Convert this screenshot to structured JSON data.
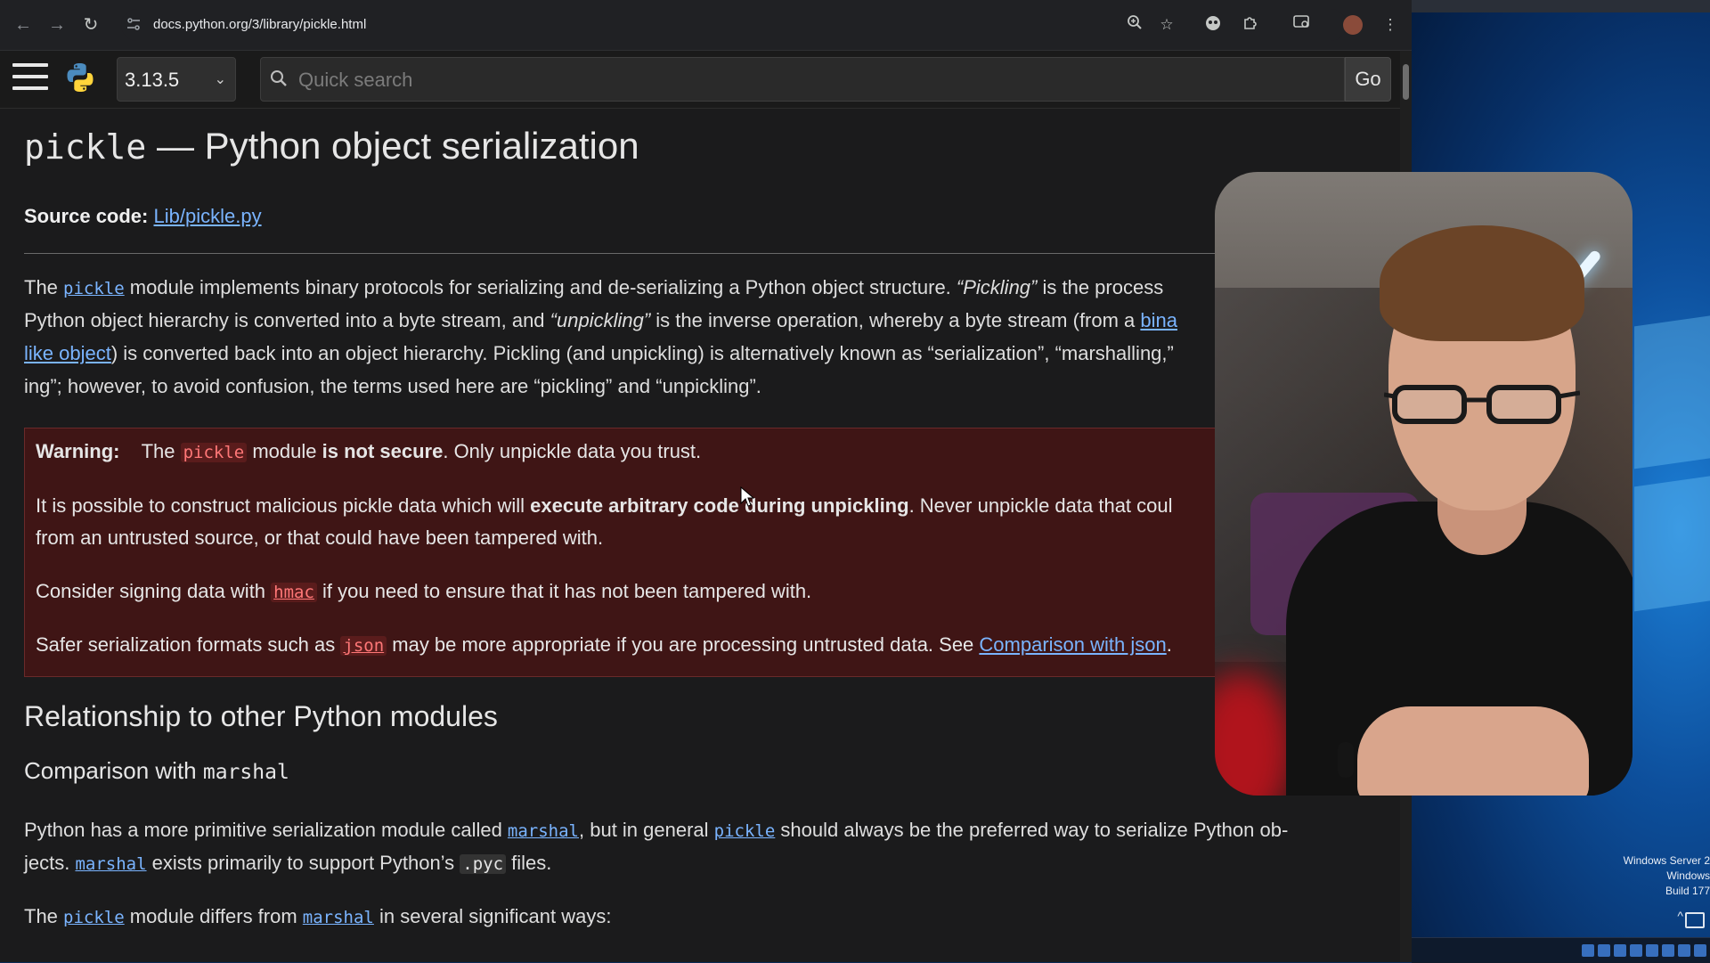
{
  "browser": {
    "url": "docs.python.org/3/library/pickle.html",
    "nav": {
      "back": "←",
      "forward": "→",
      "reload": "↻"
    },
    "icons": [
      "site-info-icon",
      "zoom-icon",
      "bookmark-star-icon",
      "extension-face-icon",
      "extensions-puzzle-icon",
      "tab-search-icon",
      "profile-avatar",
      "menu-dots-icon"
    ]
  },
  "docs_header": {
    "version": "3.13.5",
    "search_placeholder": "Quick search",
    "go_label": "Go"
  },
  "page": {
    "title_code": "pickle",
    "title_rest": " — Python object serialization",
    "source_label": "Source code:",
    "source_link": "Lib/pickle.py",
    "intro": {
      "l1_a": "The ",
      "l1_code": "pickle",
      "l1_b": " module implements binary protocols for serializing and de-serializing a Python object structure. ",
      "l1_em": "“Pickling”",
      "l1_c": " is the process",
      "l2_a": "Python object hierarchy is converted into a byte stream, and ",
      "l2_em": "“unpickling”",
      "l2_b": " is the inverse operation, whereby a byte stream (from a ",
      "l2_link": "bina",
      "l3_link": "like object",
      "l3_b": ") is converted back into an object hierarchy. Pickling (and unpickling) is alternatively known as “serialization”, “marshalling,”",
      "l4": "ing”; however, to avoid confusion, the terms used here are “pickling” and “unpickling”."
    },
    "warning": {
      "label": "Warning:",
      "w1_a": "The ",
      "w1_code": "pickle",
      "w1_b": " module ",
      "w1_strong": "is not secure",
      "w1_c": ". Only unpickle data you trust.",
      "w2_a": "It is possible to construct malicious pickle data which will ",
      "w2_strong": "execute arbitrary code during unpickling",
      "w2_b": ". Never unpickle data that coul",
      "w3": "from an untrusted source, or that could have been tampered with.",
      "w4_a": "Consider signing data with ",
      "w4_code": "hmac",
      "w4_b": " if you need to ensure that it has not been tampered with.",
      "w5_a": "Safer serialization formats such as ",
      "w5_code": "json",
      "w5_b": " may be more appropriate if you are processing untrusted data. See ",
      "w5_link": "Comparison with json",
      "w5_c": "."
    },
    "section_heading": "Relationship to other Python modules",
    "sub_heading_text": "Comparison with ",
    "sub_heading_code": "marshal",
    "p1": {
      "a": "Python has a more primitive serialization module called ",
      "code1": "marshal",
      "b": ", but in general ",
      "code2": "pickle",
      "c": " should always be the preferred way to serialize Python ob-"
    },
    "p2": {
      "a": "jects. ",
      "code1": "marshal",
      "b": " exists primarily to support Python’s ",
      "code2": ".pyc",
      "c": " files."
    },
    "p3": {
      "a": "The ",
      "code1": "pickle",
      "b": " module differs from ",
      "code2": "marshal",
      "c": " in several significant ways:"
    }
  },
  "desktop": {
    "line1": "Windows Server 2",
    "line2": "Windows",
    "line3": "Build 177"
  }
}
